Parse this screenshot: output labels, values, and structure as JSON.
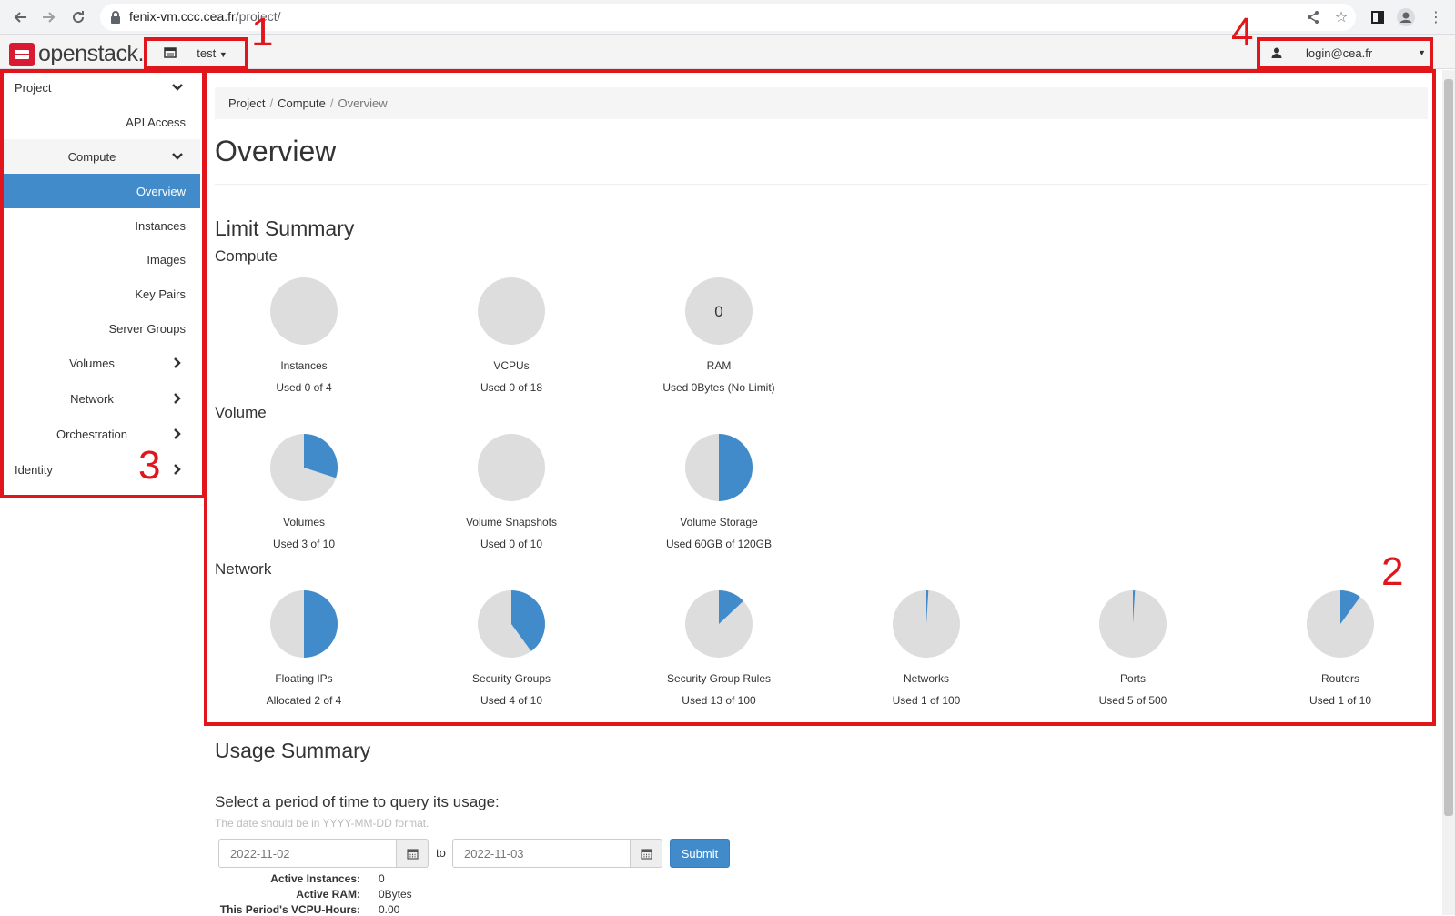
{
  "browser": {
    "url_host": "fenix-vm.ccc.cea.fr",
    "url_path": "/project/"
  },
  "header": {
    "logo_text": "openstack.",
    "project_name": "test",
    "user_name": "login@cea.fr"
  },
  "annotations": {
    "n1": "1",
    "n2": "2",
    "n3": "3",
    "n4": "4"
  },
  "sidebar": {
    "items": [
      {
        "label": "Project"
      },
      {
        "label": "API Access"
      },
      {
        "label": "Compute"
      },
      {
        "label": "Overview"
      },
      {
        "label": "Instances"
      },
      {
        "label": "Images"
      },
      {
        "label": "Key Pairs"
      },
      {
        "label": "Server Groups"
      },
      {
        "label": "Volumes"
      },
      {
        "label": "Network"
      },
      {
        "label": "Orchestration"
      },
      {
        "label": "Identity"
      }
    ]
  },
  "breadcrumb": [
    "Project",
    "Compute",
    "Overview"
  ],
  "page_title": "Overview",
  "limit_summary": {
    "title": "Limit Summary",
    "compute": {
      "title": "Compute",
      "items": [
        {
          "label": "Instances",
          "used": "Used 0 of 4",
          "fraction": 0
        },
        {
          "label": "VCPUs",
          "used": "Used 0 of 18",
          "fraction": 0
        },
        {
          "label": "RAM",
          "used": "Used 0Bytes (No Limit)",
          "fraction": 0,
          "center_text": "0"
        }
      ]
    },
    "volume": {
      "title": "Volume",
      "items": [
        {
          "label": "Volumes",
          "used": "Used 3 of 10",
          "fraction": 0.3
        },
        {
          "label": "Volume Snapshots",
          "used": "Used 0 of 10",
          "fraction": 0
        },
        {
          "label": "Volume Storage",
          "used": "Used 60GB of 120GB",
          "fraction": 0.5
        }
      ]
    },
    "network": {
      "title": "Network",
      "items": [
        {
          "label": "Floating IPs",
          "used": "Allocated 2 of 4",
          "fraction": 0.5
        },
        {
          "label": "Security Groups",
          "used": "Used 4 of 10",
          "fraction": 0.4
        },
        {
          "label": "Security Group Rules",
          "used": "Used 13 of 100",
          "fraction": 0.13
        },
        {
          "label": "Networks",
          "used": "Used 1 of 100",
          "fraction": 0.01
        },
        {
          "label": "Ports",
          "used": "Used 5 of 500",
          "fraction": 0.01
        },
        {
          "label": "Routers",
          "used": "Used 1 of 10",
          "fraction": 0.1
        }
      ]
    }
  },
  "usage_summary": {
    "title": "Usage Summary",
    "query_label": "Select a period of time to query its usage:",
    "hint": "The date should be in YYYY-MM-DD format.",
    "start_date": "2022-11-02",
    "to_label": "to",
    "end_date": "2022-11-03",
    "submit_label": "Submit",
    "stats": [
      {
        "key": "Active Instances:",
        "value": "0"
      },
      {
        "key": "Active RAM:",
        "value": "0Bytes"
      },
      {
        "key": "This Period's VCPU-Hours:",
        "value": "0.00"
      }
    ]
  },
  "colors": {
    "accent": "#428bca",
    "pie_bg": "#dddddd",
    "annotation": "#e0161c",
    "brand": "#da1a32"
  }
}
